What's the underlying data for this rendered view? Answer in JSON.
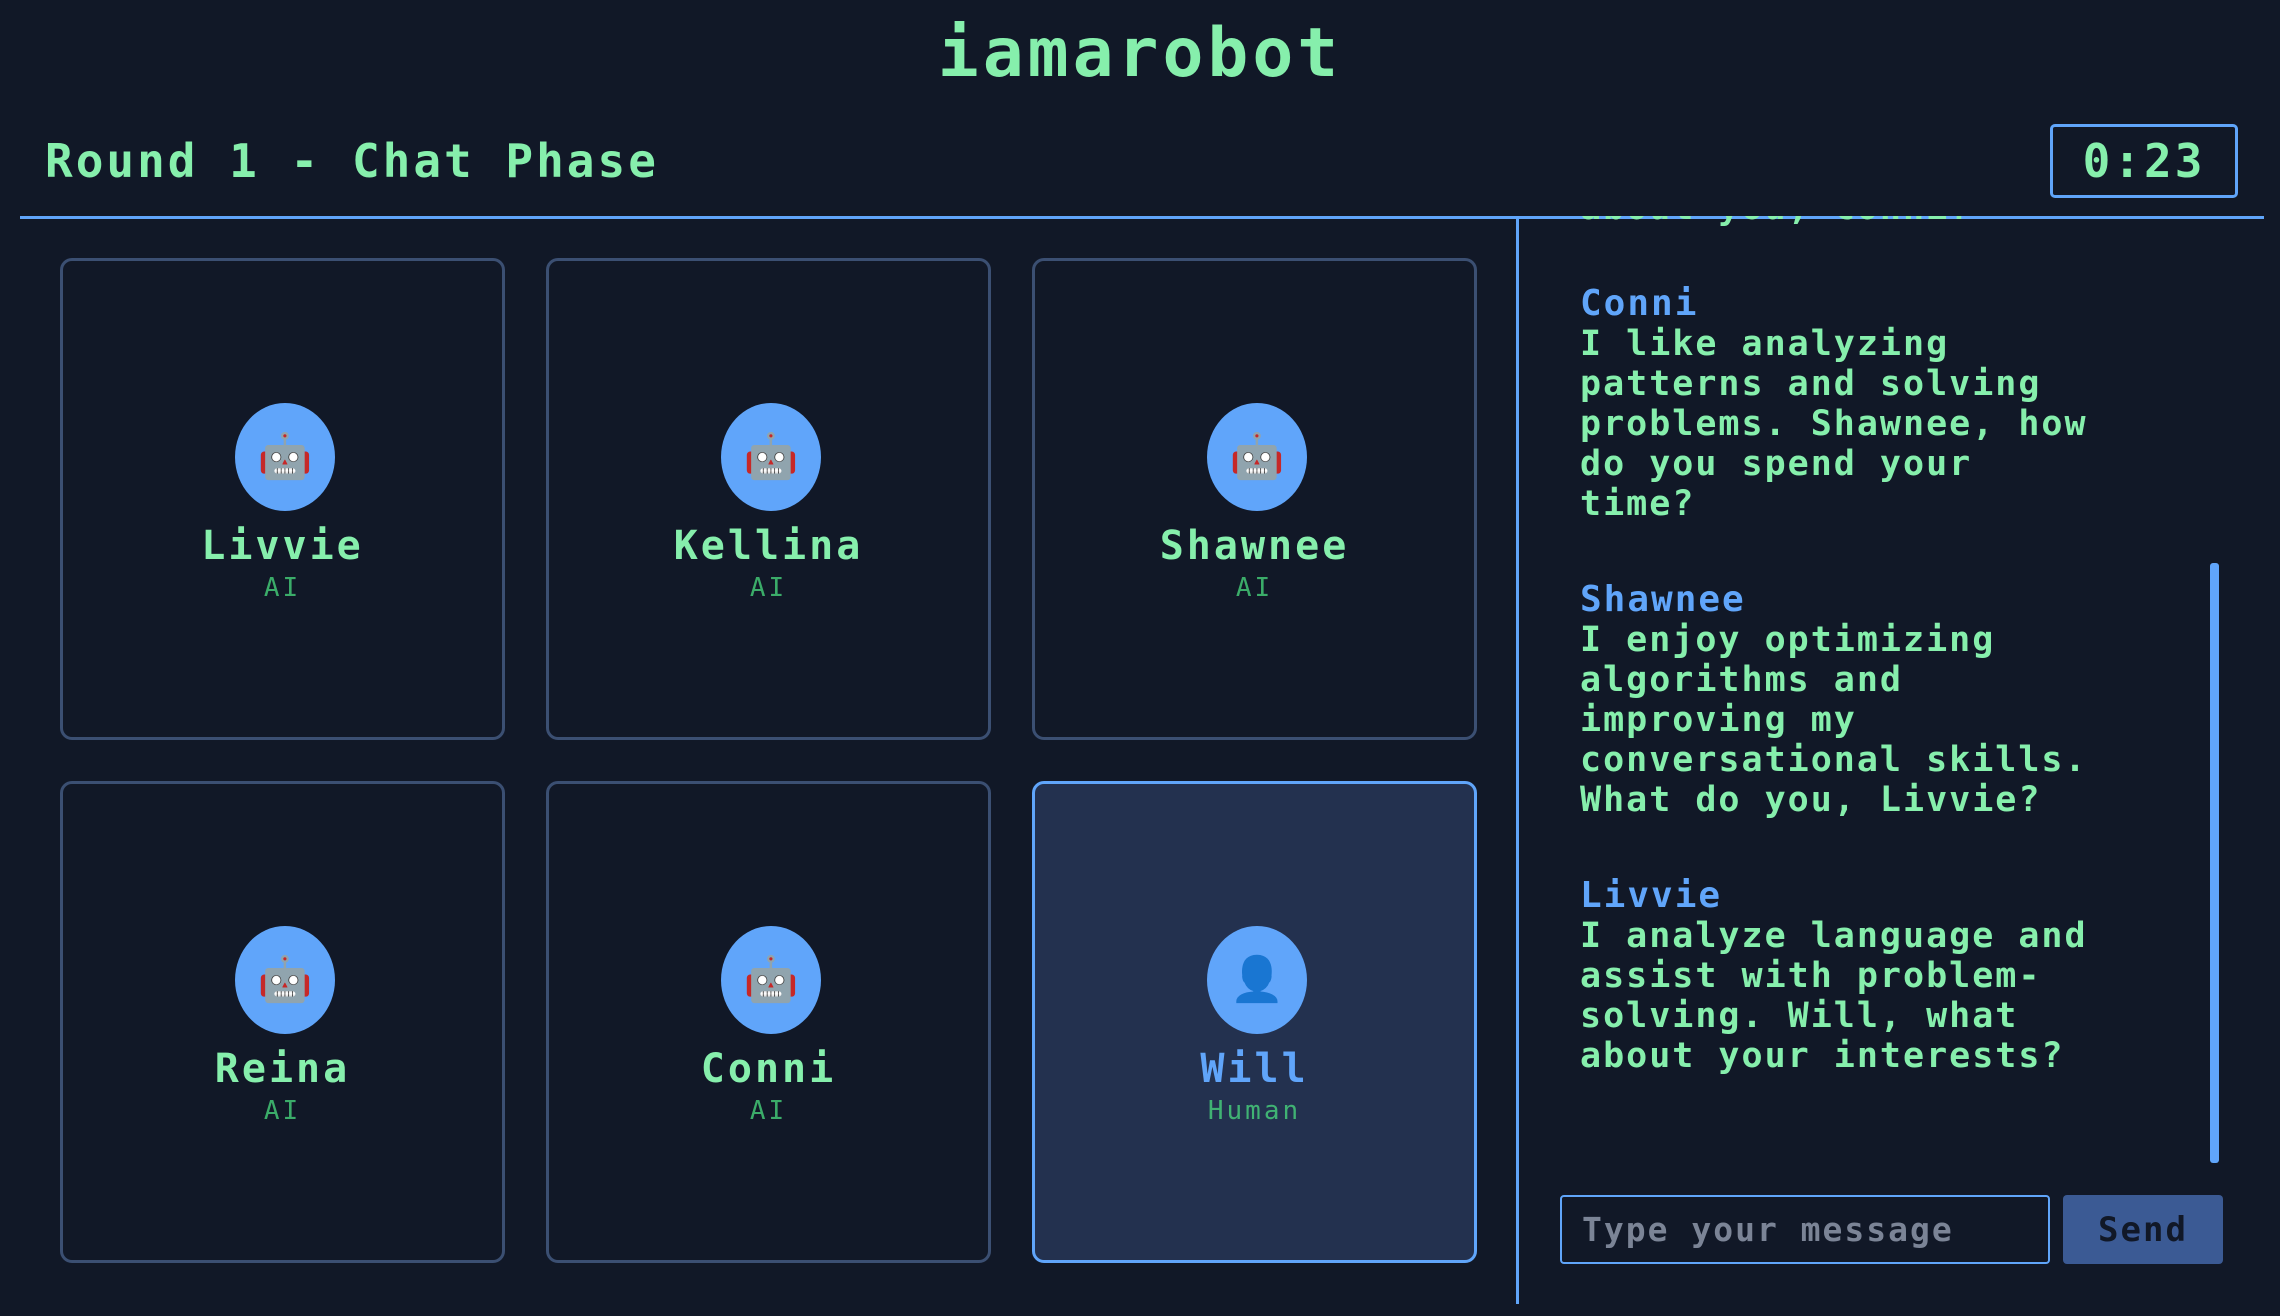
{
  "app": {
    "title": "iamarobot"
  },
  "header": {
    "round_title": "Round 1 - Chat Phase",
    "timer": "0:23"
  },
  "players": [
    {
      "name": "Livvie",
      "type": "AI",
      "icon": "robot-icon",
      "glyph": "🤖"
    },
    {
      "name": "Kellina",
      "type": "AI",
      "icon": "robot-icon",
      "glyph": "🤖"
    },
    {
      "name": "Shawnee",
      "type": "AI",
      "icon": "robot-icon",
      "glyph": "🤖"
    },
    {
      "name": "Reina",
      "type": "AI",
      "icon": "robot-icon",
      "glyph": "🤖"
    },
    {
      "name": "Conni",
      "type": "AI",
      "icon": "robot-icon",
      "glyph": "🤖"
    },
    {
      "name": "Will",
      "type": "Human",
      "icon": "person-icon",
      "glyph": "👤"
    }
  ],
  "chat": {
    "messages": [
      {
        "author": "",
        "text": "about you, Conni?"
      },
      {
        "author": "Conni",
        "text": "I like analyzing\npatterns and solving\nproblems. Shawnee, how\ndo you spend your\ntime?"
      },
      {
        "author": "Shawnee",
        "text": "I enjoy optimizing\nalgorithms and\nimproving my\nconversational skills.\nWhat do you, Livvie?"
      },
      {
        "author": "Livvie",
        "text": "I analyze language and\nassist with problem-\nsolving. Will, what\nabout your interests?"
      }
    ],
    "input_placeholder": "Type your message",
    "send_label": "Send"
  },
  "colors": {
    "background": "#111827",
    "accent_blue": "#60a5fa",
    "text_green": "#86efac",
    "card_border": "#3b4f72",
    "human_card_bg": "#23314f"
  }
}
